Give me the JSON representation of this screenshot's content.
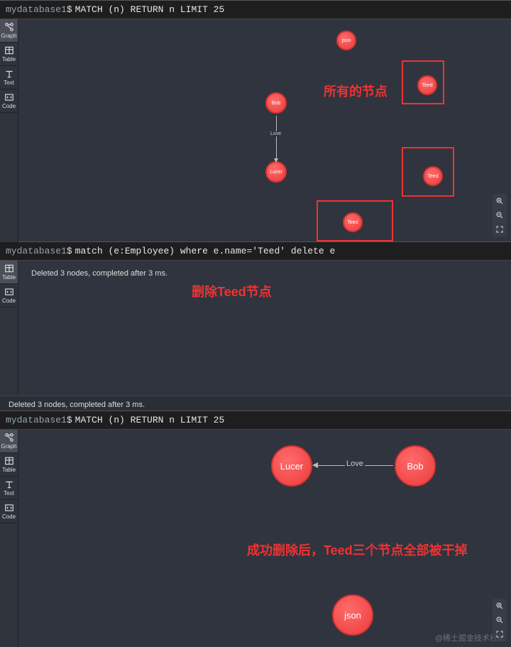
{
  "panel1": {
    "db": "mydatabase1",
    "query": "MATCH (n) RETURN n LIMIT 25",
    "sidebar": [
      {
        "label": "Graph",
        "icon": "graph-icon",
        "active": true
      },
      {
        "label": "Table",
        "icon": "table-icon",
        "active": false
      },
      {
        "label": "Text",
        "icon": "text-icon",
        "active": false
      },
      {
        "label": "Code",
        "icon": "code-icon",
        "active": false
      }
    ],
    "nodes": {
      "json": "json",
      "bob": "Bob",
      "lucer": "Lucer",
      "teed1": "Teed",
      "teed2": "Teed",
      "teed3": "Teed"
    },
    "edge_label": "Love",
    "annotation": "所有的节点"
  },
  "panel2": {
    "db": "mydatabase1",
    "query": "match (e:Employee) where e.name='Teed' delete e",
    "sidebar": [
      {
        "label": "Table",
        "icon": "table-icon",
        "active": true
      },
      {
        "label": "Code",
        "icon": "code-icon",
        "active": false
      }
    ],
    "result": "Deleted 3 nodes, completed after 3 ms.",
    "annotation": "删除Teed节点",
    "footer": "Deleted 3 nodes, completed after 3 ms."
  },
  "panel3": {
    "db": "mydatabase1",
    "query": "MATCH (n) RETURN n LIMIT 25",
    "sidebar": [
      {
        "label": "Graph",
        "icon": "graph-icon",
        "active": true
      },
      {
        "label": "Table",
        "icon": "table-icon",
        "active": false
      },
      {
        "label": "Text",
        "icon": "text-icon",
        "active": false
      },
      {
        "label": "Code",
        "icon": "code-icon",
        "active": false
      }
    ],
    "nodes": {
      "lucer": "Lucer",
      "bob": "Bob",
      "json": "json"
    },
    "edge_label": "Love",
    "annotation": "成功删除后，Teed三个节点全部被干掉"
  },
  "watermark": "@稀土掘金技术社区"
}
